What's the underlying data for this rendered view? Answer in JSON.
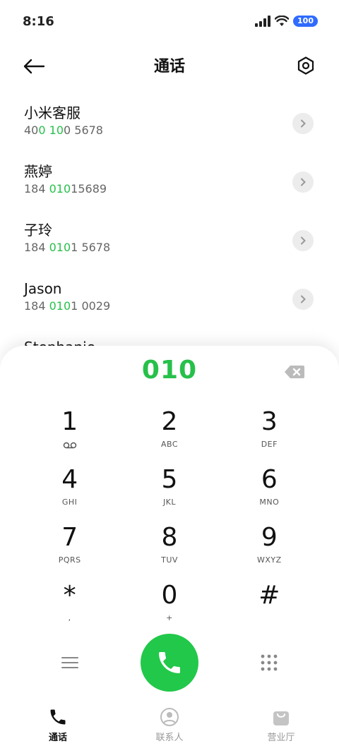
{
  "status": {
    "time": "8:16",
    "battery": "100"
  },
  "header": {
    "title": "通话"
  },
  "contacts": [
    {
      "name": "小米客服",
      "number_parts": [
        "40",
        "0",
        " ",
        "10",
        "0 5678"
      ]
    },
    {
      "name": "燕婷",
      "number_parts": [
        "184 ",
        "010",
        "15689"
      ]
    },
    {
      "name": "子玲",
      "number_parts": [
        "184 ",
        "010",
        "1 5678"
      ]
    },
    {
      "name": "Jason",
      "number_parts": [
        "184 ",
        "010",
        "1 0029"
      ]
    },
    {
      "name": "Stephanie",
      "number_parts": [
        "",
        "",
        ""
      ]
    }
  ],
  "dialer": {
    "entered": "010",
    "keys": [
      {
        "digit": "1",
        "sub": ""
      },
      {
        "digit": "2",
        "sub": "ABC"
      },
      {
        "digit": "3",
        "sub": "DEF"
      },
      {
        "digit": "4",
        "sub": "GHI"
      },
      {
        "digit": "5",
        "sub": "JKL"
      },
      {
        "digit": "6",
        "sub": "MNO"
      },
      {
        "digit": "7",
        "sub": "PQRS"
      },
      {
        "digit": "8",
        "sub": "TUV"
      },
      {
        "digit": "9",
        "sub": "WXYZ"
      },
      {
        "digit": "*",
        "sub": ","
      },
      {
        "digit": "0",
        "sub": "+"
      },
      {
        "digit": "#",
        "sub": ""
      }
    ]
  },
  "nav": {
    "calls": "通话",
    "contacts": "联系人",
    "store": "营业厅"
  },
  "colors": {
    "accent": "#27c04a",
    "call": "#22c84a"
  }
}
